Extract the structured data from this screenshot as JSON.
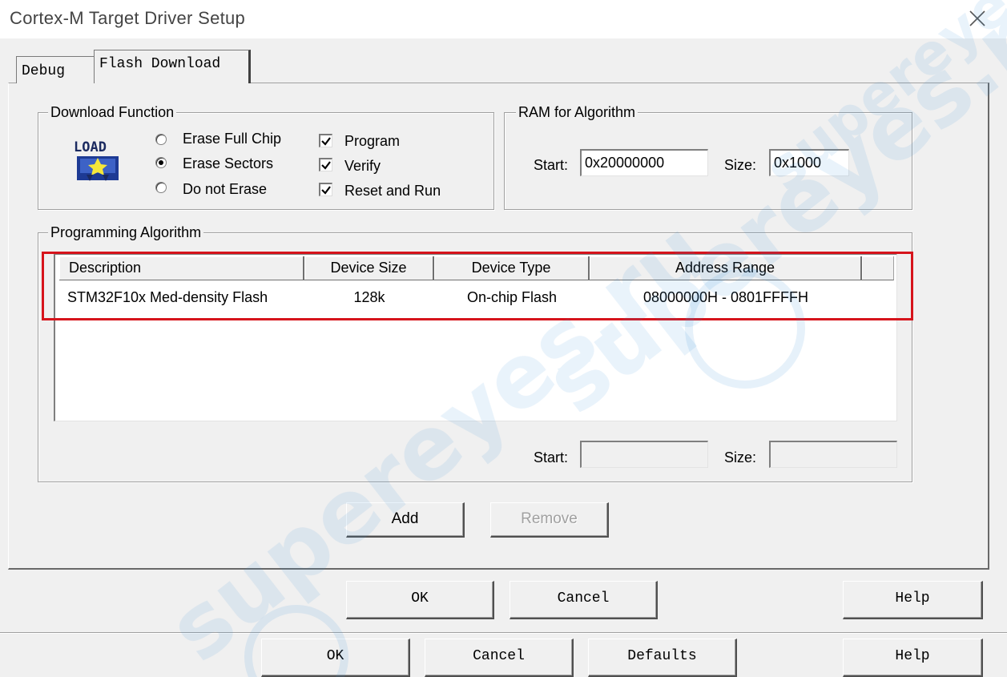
{
  "window": {
    "title": "Cortex-M Target Driver Setup"
  },
  "tabs": [
    {
      "label": "Debug",
      "active": false
    },
    {
      "label": "Flash Download",
      "active": true
    }
  ],
  "download_function": {
    "legend": "Download Function",
    "load_icon": "load-icon",
    "load_text": "LOAD",
    "radios": [
      {
        "label": "Erase Full Chip",
        "checked": false
      },
      {
        "label": "Erase Sectors",
        "checked": true
      },
      {
        "label": "Do not Erase",
        "checked": false
      }
    ],
    "checkboxes": [
      {
        "label": "Program",
        "checked": true
      },
      {
        "label": "Verify",
        "checked": true
      },
      {
        "label": "Reset and Run",
        "checked": true
      }
    ]
  },
  "ram_for_algorithm": {
    "legend": "RAM for Algorithm",
    "start_label": "Start:",
    "start_value": "0x20000000",
    "size_label": "Size:",
    "size_value": "0x1000"
  },
  "programming_algorithm": {
    "legend": "Programming Algorithm",
    "columns": [
      "Description",
      "Device Size",
      "Device Type",
      "Address Range"
    ],
    "rows": [
      {
        "description": "STM32F10x Med-density Flash",
        "device_size": "128k",
        "device_type": "On-chip Flash",
        "address_range": "08000000H - 0801FFFFH"
      }
    ],
    "start_label": "Start:",
    "start_value": "",
    "size_label": "Size:",
    "size_value": ""
  },
  "buttons": {
    "add": "Add",
    "remove": "Remove",
    "ok": "OK",
    "cancel": "Cancel",
    "help": "Help",
    "defaults": "Defaults"
  },
  "watermark": {
    "text": "supereyes.ru"
  },
  "colors": {
    "highlight": "#d6141c",
    "dialog_bg": "#f0f0f0"
  }
}
